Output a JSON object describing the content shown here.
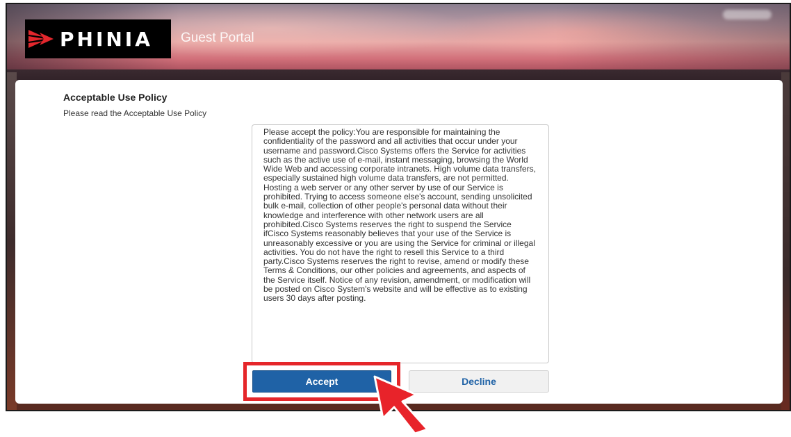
{
  "header": {
    "brand": "PHINIA",
    "portal_title": "Guest Portal"
  },
  "policy": {
    "heading": "Acceptable Use Policy",
    "subtitle": "Please read the Acceptable Use Policy",
    "text": "Please accept the policy:You are responsible for maintaining the confidentiality of the password and all activities that occur under your username and password.Cisco Systems offers the Service for activities such as the active use of e-mail, instant messaging, browsing the World Wide Web and accessing corporate intranets. High volume data transfers, especially sustained high volume data transfers, are not permitted. Hosting a web server or any other server by use of our Service is prohibited. Trying to access someone else's account, sending unsolicited bulk e-mail, collection of other people's personal data without their knowledge and interference with other network users are all prohibited.Cisco Systems reserves the right to suspend the Service ifCisco Systems reasonably believes that your use of the Service is unreasonably excessive or you are using the Service for criminal or illegal activities. You do not have the right to resell this Service to a third party.Cisco Systems reserves the right to revise, amend or modify these Terms & Conditions, our other policies and agreements, and aspects of the Service itself. Notice of any revision, amendment, or modification will be posted on Cisco System's website and will be effective as to existing users 30 days after posting."
  },
  "buttons": {
    "accept": "Accept",
    "decline": "Decline"
  },
  "icons": {
    "logo": "phinia-arrow-logo",
    "pointer": "red-arrow-pointer-icon"
  },
  "colors": {
    "accept_bg": "#1f62a6",
    "highlight": "#e5262a",
    "pointer": "#e8232a"
  }
}
